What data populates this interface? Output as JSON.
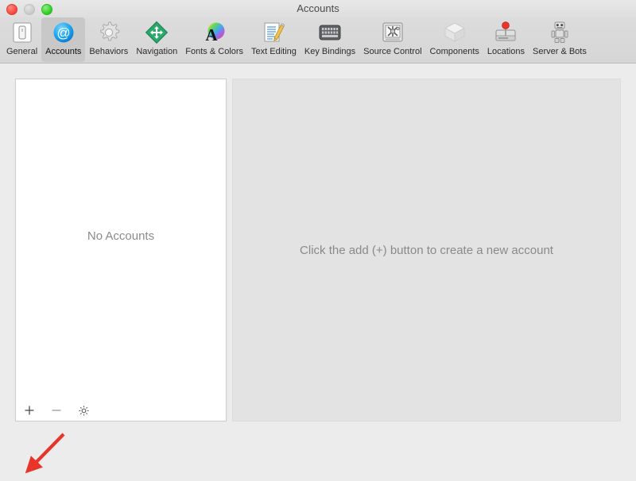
{
  "window": {
    "title": "Accounts",
    "traffic_lights": [
      {
        "name": "close",
        "color": "#f8443a"
      },
      {
        "name": "minimize",
        "color": "#c9c9c9"
      },
      {
        "name": "zoom",
        "color": "#28cd20"
      }
    ]
  },
  "toolbar": {
    "selected": "Accounts",
    "items": [
      {
        "label": "General",
        "icon": "general-icon"
      },
      {
        "label": "Accounts",
        "icon": "at-sign-icon"
      },
      {
        "label": "Behaviors",
        "icon": "gear-icon"
      },
      {
        "label": "Navigation",
        "icon": "move-arrows-icon"
      },
      {
        "label": "Fonts & Colors",
        "icon": "color-wheel-a-icon"
      },
      {
        "label": "Text Editing",
        "icon": "pencil-paper-icon"
      },
      {
        "label": "Key Bindings",
        "icon": "keyboard-icon"
      },
      {
        "label": "Source Control",
        "icon": "safe-vault-icon"
      },
      {
        "label": "Components",
        "icon": "package-box-icon"
      },
      {
        "label": "Locations",
        "icon": "hard-drive-pin-icon"
      },
      {
        "label": "Server & Bots",
        "icon": "robot-icon"
      }
    ]
  },
  "accounts_panel": {
    "empty_message": "No Accounts",
    "footer": {
      "add_label": "+",
      "remove_label": "−",
      "options_label": "gear"
    }
  },
  "detail_panel": {
    "hint": "Click the add (+) button to create a new account"
  },
  "annotation": {
    "arrow_color": "#e8352a",
    "points_at": "add-account-button"
  }
}
